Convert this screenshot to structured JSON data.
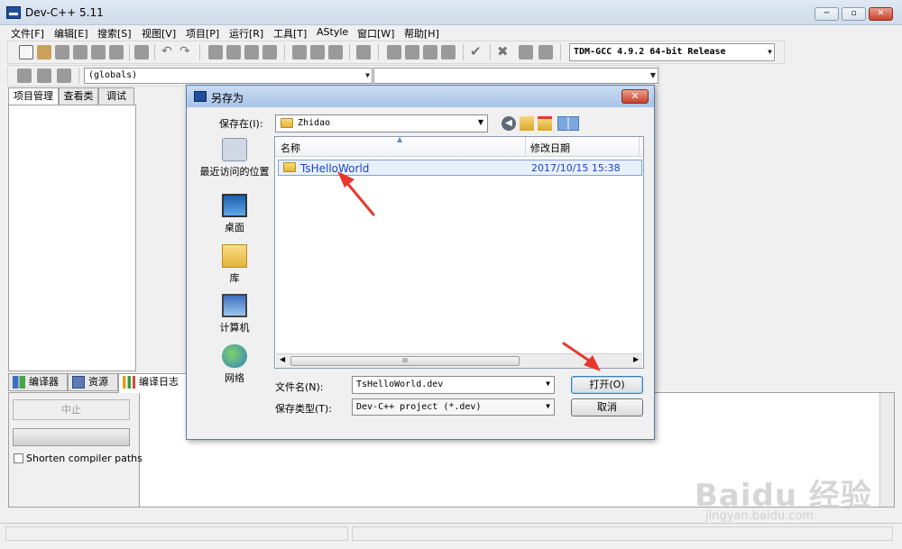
{
  "app": {
    "title": "Dev-C++ 5.11",
    "window_controls": [
      "─",
      "▫",
      "✕"
    ]
  },
  "menu": [
    "文件[F]",
    "编辑[E]",
    "搜索[S]",
    "视图[V]",
    "项目[P]",
    "运行[R]",
    "工具[T]",
    "AStyle",
    "窗口[W]",
    "帮助[H]"
  ],
  "toolbar": {
    "compiler_select": "TDM-GCC 4.9.2 64-bit Release",
    "scope_select": "(globals)",
    "function_select": ""
  },
  "left_panel": {
    "tabs": [
      "项目管理",
      "查看类",
      "调试"
    ]
  },
  "bottom_panel": {
    "tabs": [
      "编译器",
      "资源",
      "编译日志"
    ],
    "stop_button": "中止",
    "shorten_paths_label": "Shorten compiler paths"
  },
  "dialog": {
    "title": "另存为",
    "close_label": "✕",
    "save_in_label": "保存在(I):",
    "save_in_value": "Zhidao",
    "places": [
      "最近访问的位置",
      "桌面",
      "库",
      "计算机",
      "网络"
    ],
    "columns": [
      "名称",
      "修改日期"
    ],
    "files": [
      {
        "name": "TsHelloWorld",
        "date": "2017/10/15 15:38"
      }
    ],
    "filename_label": "文件名(N):",
    "filename_value": "TsHelloWorld.dev",
    "filetype_label": "保存类型(T):",
    "filetype_value": "Dev-C++ project (*.dev)",
    "open_button": "打开(O)",
    "cancel_button": "取消",
    "scroll_thumb_mark": "III"
  },
  "watermark": {
    "logo": "Baidu 经验",
    "url": "jingyan.baidu.com"
  },
  "colors": {
    "selection_text": "#1b44c4",
    "annotation_arrow": "#e8382e"
  }
}
